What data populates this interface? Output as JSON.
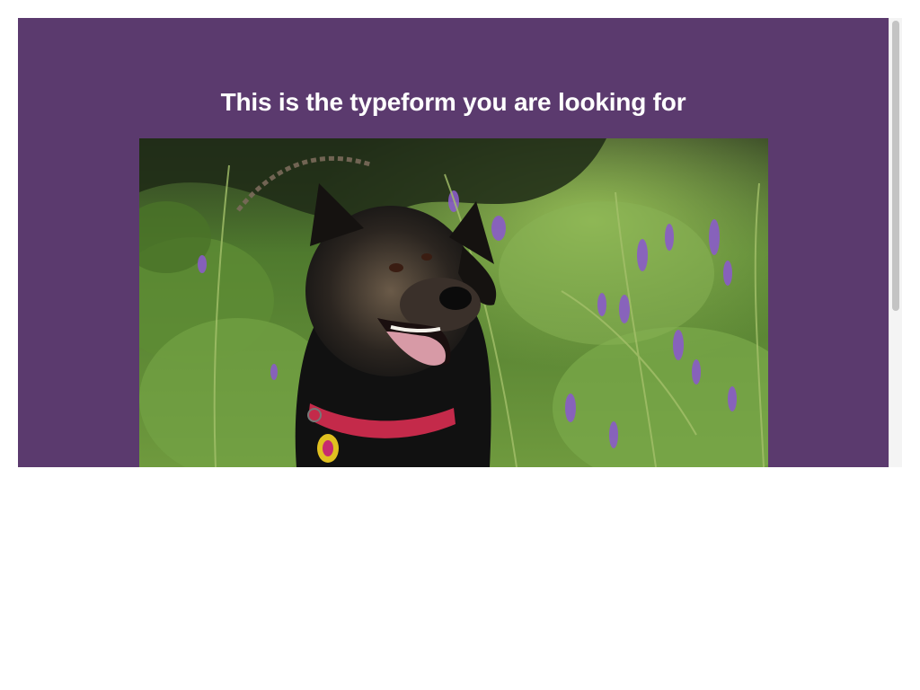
{
  "form": {
    "heading": "This is the typeform you are looking for",
    "background_color": "#5b3a6e",
    "image": {
      "subject": "black and tan dog with red collar in grass with purple wildflowers"
    }
  }
}
